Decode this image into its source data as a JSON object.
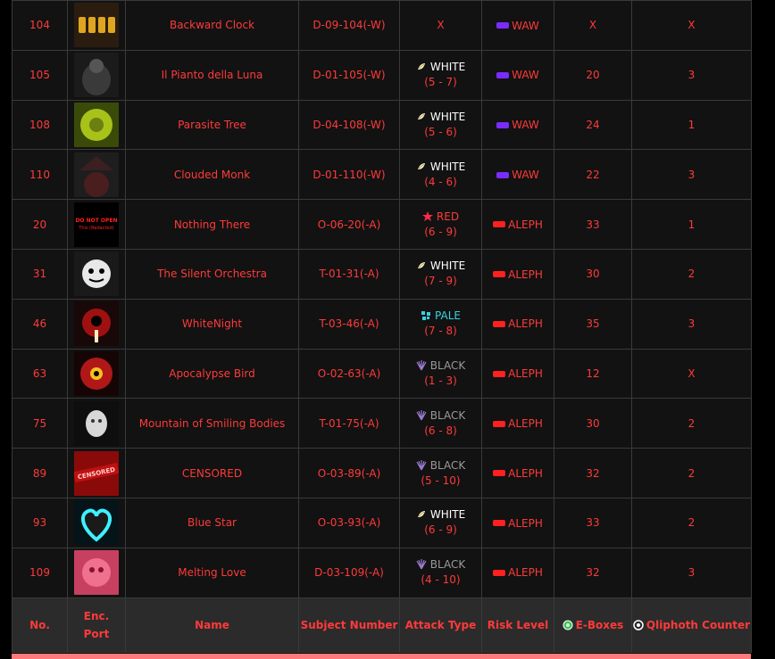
{
  "columns": {
    "no": "No.",
    "enc_port_line1": "Enc.",
    "enc_port_line2": "Port",
    "name": "Name",
    "subject_number": "Subject Number",
    "attack_type": "Attack Type",
    "risk_level": "Risk Level",
    "e_boxes": "E-Boxes",
    "qliphoth": "Qliphoth Counter"
  },
  "colors": {
    "accent": "#ff3a3a",
    "white": "#ffffff",
    "pale": "#39d0e0",
    "red": "#ff3a3a",
    "black": "#9a9a9a",
    "waw": "#7a2cff",
    "aleph": "#ff2020"
  },
  "rows": [
    {
      "no": "104",
      "name": "Backward Clock",
      "subject": "D-09-104(-W)",
      "atk_type": "X",
      "atk_kind": "none",
      "atk_range": "",
      "risk": "WAW",
      "eboxes": "X",
      "qliphoth": "X",
      "portrait": "clock-portrait"
    },
    {
      "no": "105",
      "name": "Il Pianto della Luna",
      "subject": "D-01-105(-W)",
      "atk_type": "WHITE",
      "atk_kind": "white",
      "atk_range": "(5 - 7)",
      "risk": "WAW",
      "eboxes": "20",
      "qliphoth": "3",
      "portrait": "luna-portrait"
    },
    {
      "no": "108",
      "name": "Parasite Tree",
      "subject": "D-04-108(-W)",
      "atk_type": "WHITE",
      "atk_kind": "white",
      "atk_range": "(5 - 6)",
      "risk": "WAW",
      "eboxes": "24",
      "qliphoth": "1",
      "portrait": "tree-portrait"
    },
    {
      "no": "110",
      "name": "Clouded Monk",
      "subject": "D-01-110(-W)",
      "atk_type": "WHITE",
      "atk_kind": "white",
      "atk_range": "(4 - 6)",
      "risk": "WAW",
      "eboxes": "22",
      "qliphoth": "3",
      "portrait": "monk-portrait"
    },
    {
      "no": "20",
      "name": "Nothing There",
      "subject": "O-06-20(-A)",
      "atk_type": "RED",
      "atk_kind": "red",
      "atk_range": "(6 - 9)",
      "risk": "ALEPH",
      "eboxes": "33",
      "qliphoth": "1",
      "portrait": "nothing-there-portrait"
    },
    {
      "no": "31",
      "name": "The Silent Orchestra",
      "subject": "T-01-31(-A)",
      "atk_type": "WHITE",
      "atk_kind": "white",
      "atk_range": "(7 - 9)",
      "risk": "ALEPH",
      "eboxes": "30",
      "qliphoth": "2",
      "portrait": "orchestra-portrait"
    },
    {
      "no": "46",
      "name": "WhiteNight",
      "subject": "T-03-46(-A)",
      "atk_type": "PALE",
      "atk_kind": "pale",
      "atk_range": "(7 - 8)",
      "risk": "ALEPH",
      "eboxes": "35",
      "qliphoth": "3",
      "portrait": "whitenight-portrait"
    },
    {
      "no": "63",
      "name": "Apocalypse Bird",
      "subject": "O-02-63(-A)",
      "atk_type": "BLACK",
      "atk_kind": "black",
      "atk_range": "(1 - 3)",
      "risk": "ALEPH",
      "eboxes": "12",
      "qliphoth": "X",
      "portrait": "apocalypse-portrait"
    },
    {
      "no": "75",
      "name": "Mountain of Smiling Bodies",
      "subject": "T-01-75(-A)",
      "atk_type": "BLACK",
      "atk_kind": "black",
      "atk_range": "(6 - 8)",
      "risk": "ALEPH",
      "eboxes": "30",
      "qliphoth": "2",
      "portrait": "mountain-portrait"
    },
    {
      "no": "89",
      "name": "CENSORED",
      "subject": "O-03-89(-A)",
      "atk_type": "BLACK",
      "atk_kind": "black",
      "atk_range": "(5 - 10)",
      "risk": "ALEPH",
      "eboxes": "32",
      "qliphoth": "2",
      "portrait": "censored-portrait"
    },
    {
      "no": "93",
      "name": "Blue Star",
      "subject": "O-03-93(-A)",
      "atk_type": "WHITE",
      "atk_kind": "white",
      "atk_range": "(6 - 9)",
      "risk": "ALEPH",
      "eboxes": "33",
      "qliphoth": "2",
      "portrait": "bluestar-portrait"
    },
    {
      "no": "109",
      "name": "Melting Love",
      "subject": "D-03-109(-A)",
      "atk_type": "BLACK",
      "atk_kind": "black",
      "atk_range": "(4 - 10)",
      "risk": "ALEPH",
      "eboxes": "32",
      "qliphoth": "3",
      "portrait": "melting-love-portrait"
    }
  ],
  "portrait_text": {
    "nothing_there_line1": "DO NOT OPEN",
    "nothing_there_line2": "This (Redacted)",
    "censored": "CENSORED"
  }
}
